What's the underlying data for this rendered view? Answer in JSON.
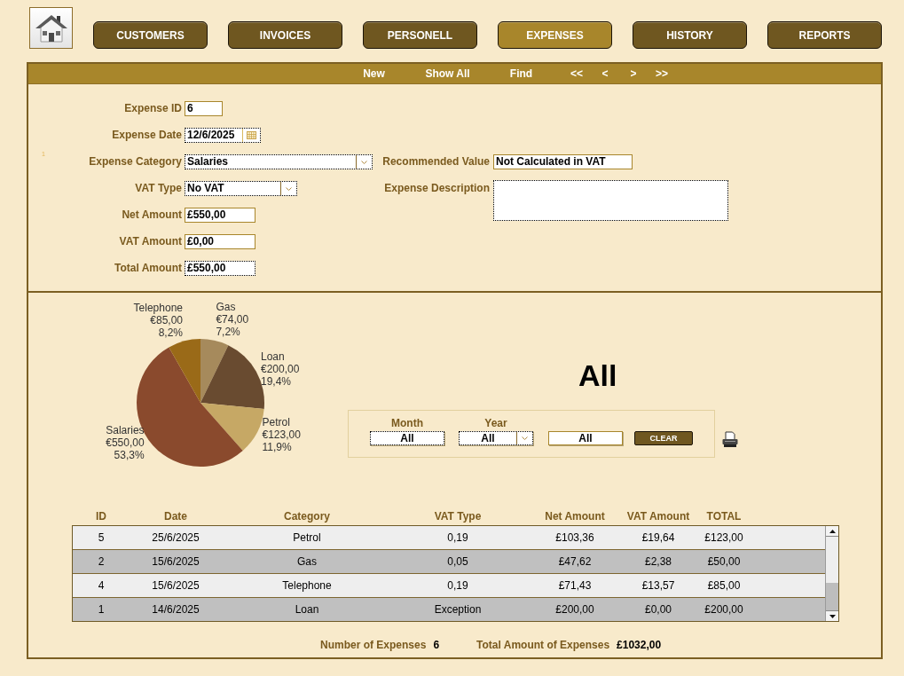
{
  "nav": {
    "tabs": [
      {
        "label": "CUSTOMERS",
        "selected": false
      },
      {
        "label": "INVOICES",
        "selected": false
      },
      {
        "label": "PERSONELL",
        "selected": false
      },
      {
        "label": "EXPENSES",
        "selected": true
      },
      {
        "label": "HISTORY",
        "selected": false
      },
      {
        "label": "REPORTS",
        "selected": false
      }
    ]
  },
  "toolbar": [
    {
      "label": "New",
      "kind": "command"
    },
    {
      "label": "Show All",
      "kind": "command"
    },
    {
      "label": "Find",
      "kind": "command"
    },
    {
      "label": "<<",
      "kind": "arrow"
    },
    {
      "label": "<",
      "kind": "arrow"
    },
    {
      "label": ">",
      "kind": "arrow"
    },
    {
      "label": ">>",
      "kind": "arrow"
    }
  ],
  "form": {
    "mark": "1",
    "fields": [
      {
        "label": "Expense ID",
        "value": "6",
        "kind": "text"
      },
      {
        "label": "Expense Date",
        "value": "12/6/2025",
        "kind": "date"
      },
      {
        "label": "Expense Category",
        "value": "Salaries",
        "kind": "combo"
      },
      {
        "label": "VAT Type",
        "value": "No VAT",
        "kind": "combo"
      },
      {
        "label": "Net Amount",
        "value": "£550,00",
        "kind": "text"
      },
      {
        "label": "VAT Amount",
        "value": "£0,00",
        "kind": "text"
      },
      {
        "label": "Total Amount",
        "value": "£550,00",
        "kind": "text"
      }
    ],
    "side_fields": [
      {
        "label": "Recommended Value",
        "value": "Not Calculated in VAT",
        "kind": "text"
      },
      {
        "label": "Expense Description",
        "kind": "memo"
      }
    ]
  },
  "summary": {
    "chart_data": [
      {
        "type": "pie",
        "categories": [
          "Gas",
          "Loan",
          "Petrol",
          "Salaries",
          "Telephone"
        ],
        "values": [
          74,
          200,
          123,
          550,
          85
        ],
        "colors": [
          "#a68a5c",
          "#694b30",
          "#c6a865",
          "#8a4a2d",
          "#9a6a18"
        ],
        "value_labels": [
          "€74,00\n7,2%",
          "€200,00\n19,4%",
          "€123,00\n11,9%",
          "€550,00\n53,3%",
          "€85,00\n8,2%"
        ]
      }
    ],
    "period_title": "All",
    "filters": [
      {
        "label": "Month",
        "value": "All",
        "kind": "text"
      },
      {
        "label": "Year",
        "value": "All",
        "kind": "combo"
      },
      {
        "value": "All",
        "kind": "text"
      }
    ],
    "clear_button": "CLEAR"
  },
  "table": {
    "columns": [
      "ID",
      "Date",
      "Category",
      "VAT Type",
      "Net Amount",
      "VAT Amount",
      "TOTAL"
    ],
    "rows": [
      [
        "5",
        "25/6/2025",
        "Petrol",
        "0,19",
        "£103,36",
        "£19,64",
        "£123,00"
      ],
      [
        "2",
        "15/6/2025",
        "Gas",
        "0,05",
        "£47,62",
        "£2,38",
        "£50,00"
      ],
      [
        "4",
        "15/6/2025",
        "Telephone",
        "0,19",
        "£71,43",
        "£13,57",
        "£85,00"
      ],
      [
        "1",
        "14/6/2025",
        "Loan",
        "Exception",
        "£200,00",
        "£0,00",
        "£200,00"
      ]
    ]
  },
  "footer": [
    {
      "label": "Number of Expenses",
      "value": "6"
    },
    {
      "label": "Total Amount of Expenses",
      "value": "£1032,00"
    }
  ]
}
